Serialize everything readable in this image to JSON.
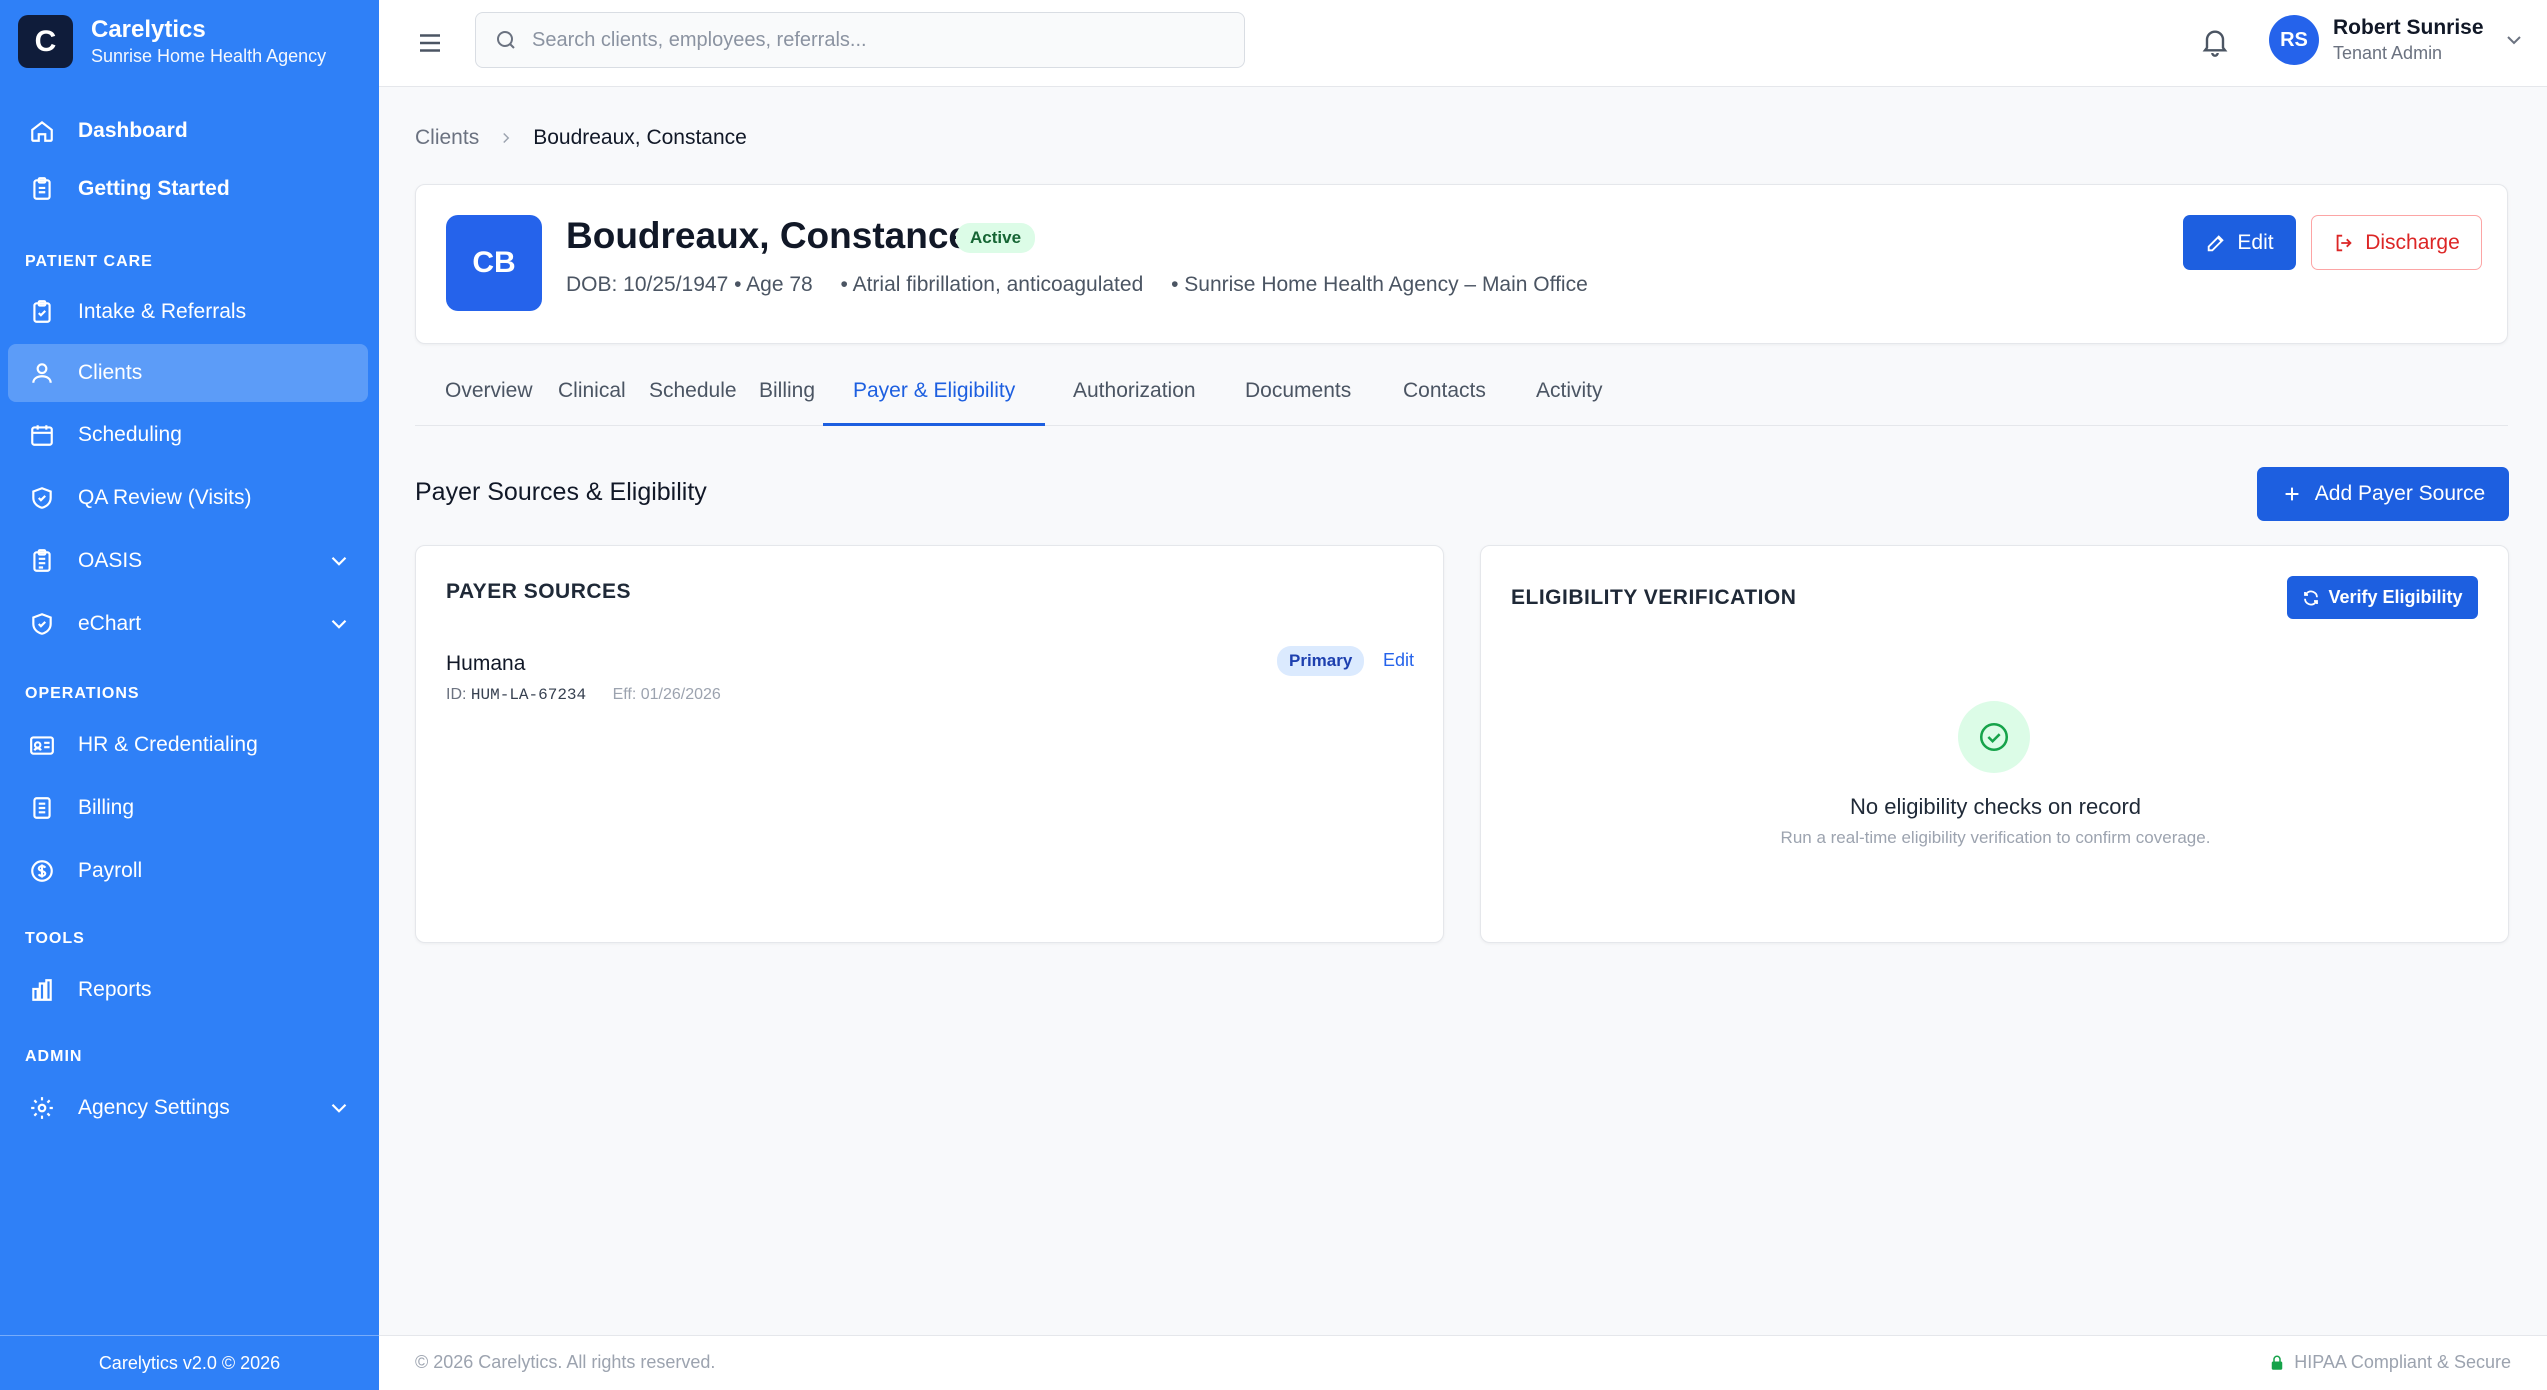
{
  "brand": {
    "logo_letter": "C",
    "name": "Carelytics",
    "agency": "Sunrise Home Health Agency"
  },
  "sidebar": {
    "items": [
      {
        "label": "Dashboard",
        "icon": "home-icon"
      },
      {
        "label": "Getting Started",
        "icon": "clipboard-icon"
      },
      {
        "label": "Intake & Referrals",
        "icon": "clipboard-check-icon"
      },
      {
        "label": "Clients",
        "icon": "users-icon"
      },
      {
        "label": "Scheduling",
        "icon": "calendar-icon"
      },
      {
        "label": "QA Review (Visits)",
        "icon": "shield-check-icon"
      },
      {
        "label": "OASIS",
        "icon": "clipboard-list-icon"
      },
      {
        "label": "eChart",
        "icon": "shield-check-icon"
      },
      {
        "label": "HR & Credentialing",
        "icon": "id-card-icon"
      },
      {
        "label": "Billing",
        "icon": "receipt-icon"
      },
      {
        "label": "Payroll",
        "icon": "dollar-circle-icon"
      },
      {
        "label": "Reports",
        "icon": "bar-chart-icon"
      },
      {
        "label": "Agency Settings",
        "icon": "gear-icon"
      }
    ],
    "sections": {
      "patient_care": "PATIENT CARE",
      "operations": "OPERATIONS",
      "tools": "TOOLS",
      "admin": "ADMIN"
    },
    "active_item": "Clients",
    "footer": "Carelytics v2.0 © 2026"
  },
  "topbar": {
    "search_placeholder": "Search clients, employees, referrals...",
    "user_initials": "RS",
    "user_name": "Robert Sunrise",
    "user_role": "Tenant Admin"
  },
  "breadcrumb": {
    "parent": "Clients",
    "current": "Boudreaux, Constance"
  },
  "client": {
    "initials": "CB",
    "name": "Boudreaux, Constance",
    "status": "Active",
    "dob_age": "DOB: 10/25/1947 • Age 78",
    "diagnosis": "• Atrial fibrillation, anticoagulated",
    "office": "• Sunrise Home Health Agency – Main Office",
    "edit_label": "Edit",
    "discharge_label": "Discharge"
  },
  "tabs": [
    "Overview",
    "Clinical",
    "Schedule",
    "Billing",
    "Payer & Eligibility",
    "Authorization",
    "Documents",
    "Contacts",
    "Activity"
  ],
  "active_tab": "Payer & Eligibility",
  "payer_section": {
    "title": "Payer Sources & Eligibility",
    "add_label": "Add Payer Source",
    "sources_title": "PAYER SOURCES",
    "payer": {
      "name": "Humana",
      "id_label": "ID:",
      "id_value": "HUM-LA-67234",
      "effective": "Eff: 01/26/2026",
      "badge": "Primary",
      "edit_label": "Edit"
    },
    "eligibility_title": "ELIGIBILITY VERIFICATION",
    "verify_label": "Verify Eligibility",
    "empty_title": "No eligibility checks on record",
    "empty_subtitle": "Run a real-time eligibility verification to confirm coverage."
  },
  "footer": {
    "copyright": "© 2026 Carelytics. All rights reserved.",
    "compliance": "HIPAA Compliant & Secure"
  },
  "colors": {
    "sidebar": "#2f80f7",
    "primary": "#1d5fe0",
    "danger": "#dc2626",
    "success": "#16a34a"
  }
}
